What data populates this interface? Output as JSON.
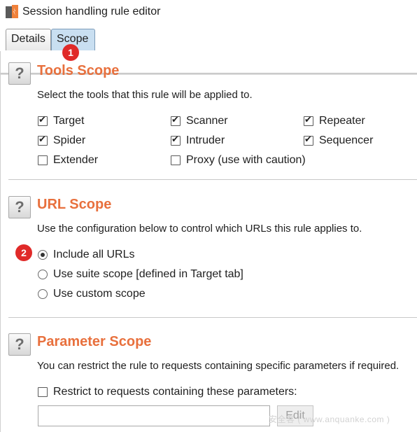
{
  "window": {
    "title": "Session handling rule editor"
  },
  "tabs": [
    {
      "label": "Details"
    },
    {
      "label": "Scope"
    }
  ],
  "badges": {
    "one": "1",
    "two": "2"
  },
  "tools_scope": {
    "title": "Tools Scope",
    "description": "Select the tools that this rule will be applied to.",
    "items": [
      {
        "label": "Target",
        "checked": true
      },
      {
        "label": "Scanner",
        "checked": true
      },
      {
        "label": "Repeater",
        "checked": true
      },
      {
        "label": "Spider",
        "checked": true
      },
      {
        "label": "Intruder",
        "checked": true
      },
      {
        "label": "Sequencer",
        "checked": true
      },
      {
        "label": "Extender",
        "checked": false
      },
      {
        "label": "Proxy (use with caution)",
        "checked": false
      }
    ]
  },
  "url_scope": {
    "title": "URL Scope",
    "description": "Use the configuration below to control which URLs this rule applies to.",
    "options": [
      {
        "label": "Include all URLs",
        "selected": true
      },
      {
        "label": "Use suite scope [defined in Target tab]",
        "selected": false
      },
      {
        "label": "Use custom scope",
        "selected": false
      }
    ]
  },
  "parameter_scope": {
    "title": "Parameter Scope",
    "description": "You can restrict the rule to requests containing specific parameters if required.",
    "restrict_label": "Restrict to requests containing these parameters:",
    "restrict_checked": false,
    "input_value": "",
    "edit_label": "Edit"
  },
  "help_label": "?",
  "watermark": "安全客 ( www.anquanke.com )",
  "colors": {
    "section_title": "#e8703d",
    "active_tab": "#c9dff1",
    "badge": "#e02a29"
  }
}
